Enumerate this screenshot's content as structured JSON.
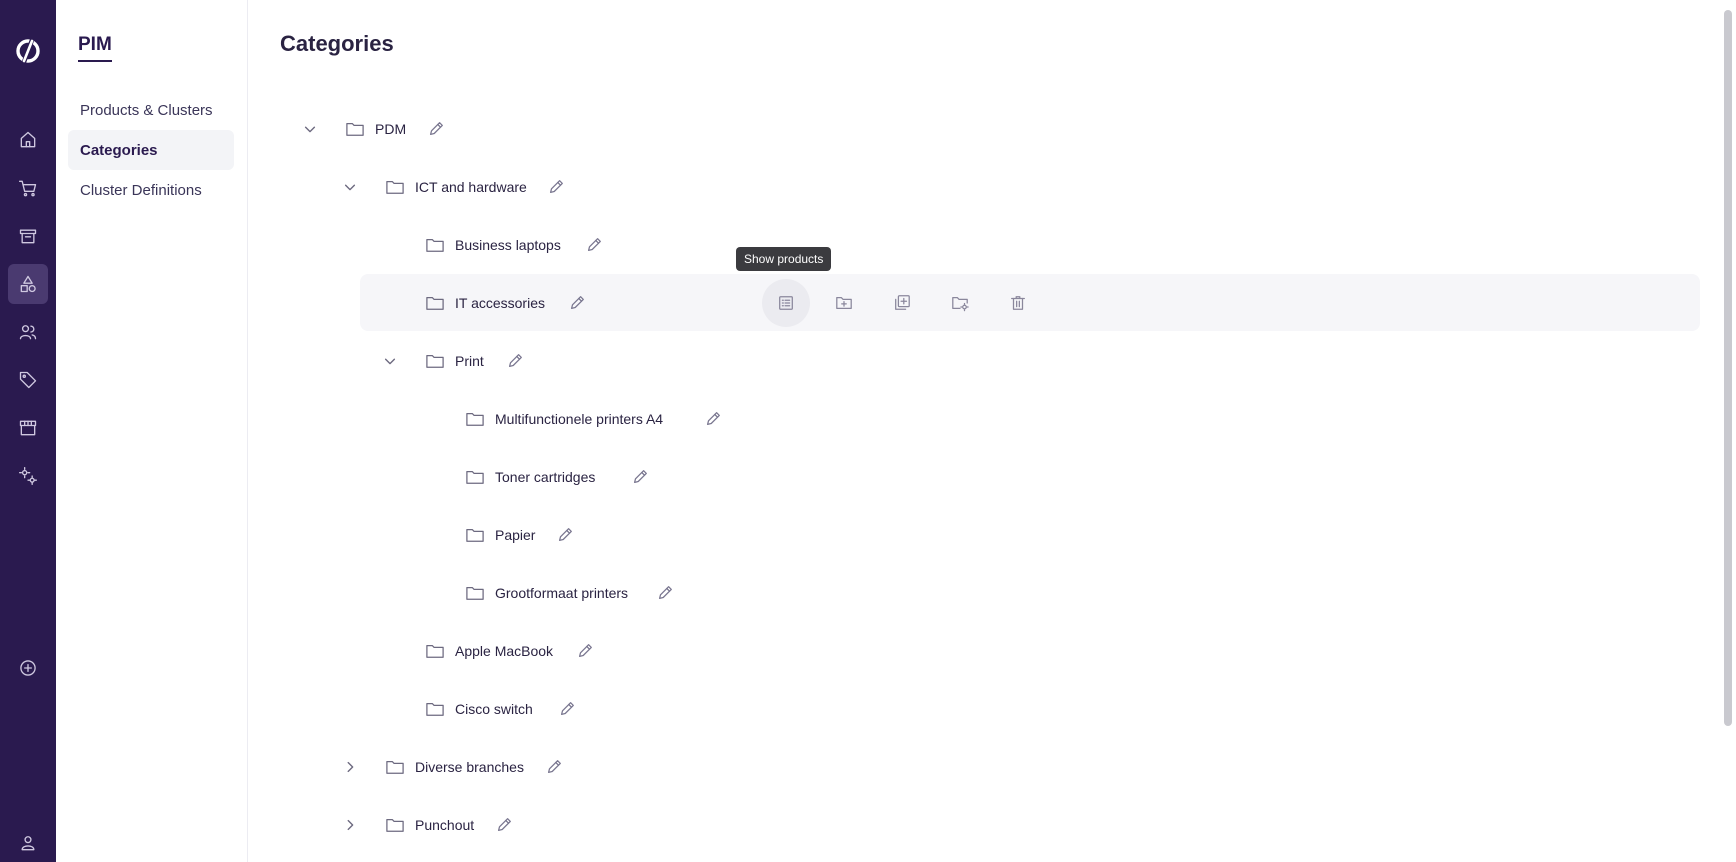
{
  "rail": {
    "items": [
      {
        "name": "home-icon"
      },
      {
        "name": "cart-icon"
      },
      {
        "name": "store-icon"
      },
      {
        "name": "shapes-icon",
        "active": true
      },
      {
        "name": "users-icon"
      },
      {
        "name": "tag-icon"
      },
      {
        "name": "shop-icon"
      },
      {
        "name": "settings-icon"
      },
      {
        "name": "plus-circle-icon"
      },
      {
        "name": "user-icon"
      }
    ]
  },
  "subnav": {
    "title": "PIM",
    "items": [
      {
        "label": "Products & Clusters"
      },
      {
        "label": "Categories",
        "active": true
      },
      {
        "label": "Cluster Definitions"
      }
    ]
  },
  "page": {
    "title": "Categories"
  },
  "tree": {
    "nodes": [
      {
        "label": "PDM",
        "depth": 0,
        "expander": "expanded"
      },
      {
        "label": "ICT and hardware",
        "depth": 1,
        "expander": "expanded"
      },
      {
        "label": "Business laptops",
        "depth": 2,
        "expander": "none"
      },
      {
        "label": "IT accessories",
        "depth": 2,
        "expander": "none",
        "hovered": true
      },
      {
        "label": "Print",
        "depth": 2,
        "expander": "expanded"
      },
      {
        "label": "Multifunctionele printers A4",
        "depth": 3,
        "expander": "none"
      },
      {
        "label": "Toner cartridges",
        "depth": 3,
        "expander": "none"
      },
      {
        "label": "Papier",
        "depth": 3,
        "expander": "none"
      },
      {
        "label": "Grootformaat printers",
        "depth": 3,
        "expander": "none"
      },
      {
        "label": "Apple MacBook",
        "depth": 2,
        "expander": "none"
      },
      {
        "label": "Cisco switch",
        "depth": 2,
        "expander": "none"
      },
      {
        "label": "Diverse branches",
        "depth": 1,
        "expander": "collapsed"
      },
      {
        "label": "Punchout",
        "depth": 1,
        "expander": "collapsed"
      }
    ]
  },
  "row_actions": {
    "items": [
      {
        "name": "show-products-icon"
      },
      {
        "name": "add-folder-icon"
      },
      {
        "name": "copy-add-icon"
      },
      {
        "name": "folder-settings-icon"
      },
      {
        "name": "trash-icon"
      }
    ],
    "tooltip": "Show products"
  },
  "colors": {
    "rail_bg": "#2a1a4f",
    "accent": "#2a1a4f",
    "hover_row": "#f6f6f9",
    "tooltip_bg": "#3b3b3f"
  }
}
